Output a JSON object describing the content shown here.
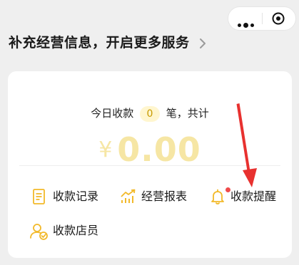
{
  "capsule": {
    "more_icon": "more-dots-icon",
    "close_icon": "target-icon"
  },
  "promo": {
    "text": "补充经营信息，开启更多服务",
    "icon": "chevron-right-icon"
  },
  "summary": {
    "label_before": "今日收款",
    "count": "0",
    "label_after": "笔，共计",
    "currency": "¥",
    "amount": "0.00"
  },
  "menu": [
    {
      "label": "收款记录",
      "icon": "receipt-document-icon"
    },
    {
      "label": "经营报表",
      "icon": "trend-chart-icon"
    },
    {
      "label": "收款提醒",
      "icon": "bell-icon",
      "badge": true
    },
    {
      "label": "收款店员",
      "icon": "staff-user-icon"
    }
  ],
  "colors": {
    "accent": "#f2c230",
    "amount": "#f6e6a4",
    "badge_bg": "#fff6cf",
    "badge_text": "#c89b00",
    "red_dot": "#f04b4b",
    "arrow": "#e8312f"
  }
}
